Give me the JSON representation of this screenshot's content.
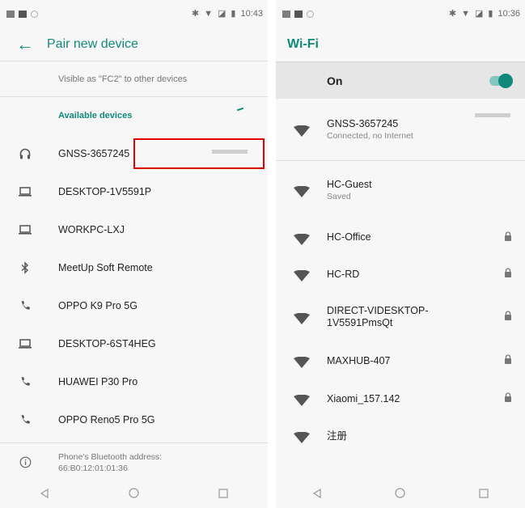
{
  "left": {
    "status": {
      "time": "10:43"
    },
    "header": {
      "title": "Pair new device"
    },
    "visible_as": "Visible as \"FC2\" to other devices",
    "section_title": "Available devices",
    "devices": [
      {
        "name": "GNSS-3657245",
        "icon": "headphones-icon"
      },
      {
        "name": "DESKTOP-1V5591P",
        "icon": "laptop-icon"
      },
      {
        "name": "WORKPC-LXJ",
        "icon": "laptop-icon"
      },
      {
        "name": "MeetUp Soft Remote",
        "icon": "bluetooth-icon"
      },
      {
        "name": "OPPO K9 Pro 5G",
        "icon": "phone-icon"
      },
      {
        "name": "DESKTOP-6ST4HEG",
        "icon": "laptop-icon"
      },
      {
        "name": "HUAWEI P30 Pro",
        "icon": "phone-icon"
      },
      {
        "name": "OPPO Reno5 Pro 5G",
        "icon": "phone-icon"
      }
    ],
    "bt_address_label": "Phone's Bluetooth address:",
    "bt_address_value": "66:B0:12:01:01:36"
  },
  "right": {
    "status": {
      "time": "10:36"
    },
    "header": {
      "title": "Wi-Fi"
    },
    "toggle_label": "On",
    "networks": [
      {
        "name": "GNSS-3657245",
        "status": "Connected, no Internet",
        "locked": false
      },
      {
        "name": "HC-Guest",
        "status": "Saved",
        "locked": false
      },
      {
        "name": "HC-Office",
        "status": "",
        "locked": true
      },
      {
        "name": "HC-RD",
        "status": "",
        "locked": true
      },
      {
        "name": "DIRECT-VIDESKTOP-\n1V5591PmsQt",
        "status": "",
        "locked": true
      },
      {
        "name": "MAXHUB-407",
        "status": "",
        "locked": true
      },
      {
        "name": "Xiaomi_157.142",
        "status": "",
        "locked": true
      },
      {
        "name": "注册",
        "status": "",
        "locked": false
      }
    ]
  },
  "colors": {
    "accent": "#11897a",
    "highlight": "#e00000"
  }
}
